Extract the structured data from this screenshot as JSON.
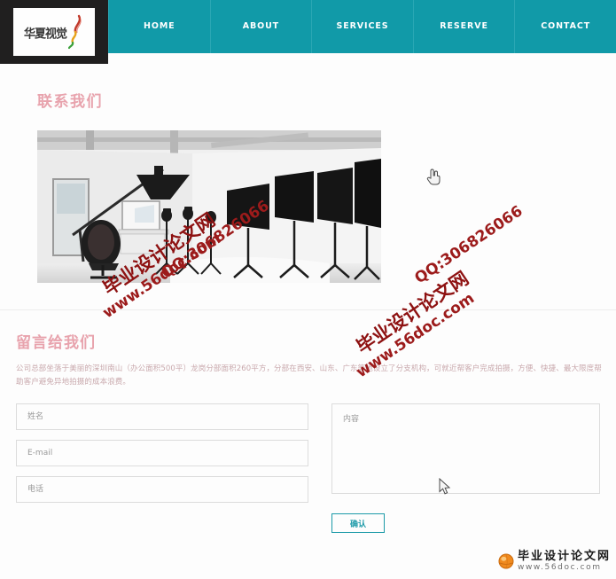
{
  "header": {
    "logo": {
      "text": "华夏视觉",
      "icon": "ribbon-swoosh-icon"
    },
    "nav": [
      {
        "label": "HOME"
      },
      {
        "label": "ABOUT"
      },
      {
        "label": "SERVICES"
      },
      {
        "label": "RESERVE"
      },
      {
        "label": "CONTACT"
      }
    ],
    "accent_color": "#119aa8"
  },
  "contact": {
    "title": "联系我们",
    "title_color": "#e8a3ad",
    "photo_alt": "photography-studio-photo"
  },
  "message": {
    "title": "留言给我们",
    "body": "公司总部坐落于美丽的深圳南山（办公面积500平）龙岗分部面积260平方，分部在西安、山东、广东等地设立了分支机构，可就近帮客户完成拍摄，方便、快捷、最大限度帮助客户避免异地拍摄的成本浪费。"
  },
  "form": {
    "name_placeholder": "姓名",
    "name_value": "",
    "email_placeholder": "E-mail",
    "email_value": "",
    "phone_placeholder": "电话",
    "phone_value": "",
    "content_placeholder": "内容",
    "content_value": "",
    "submit_label": "确认",
    "submit_color": "#1c9aa8"
  },
  "watermarks": [
    {
      "text": "QQ:306826066",
      "color": "#9c1b1b"
    },
    {
      "text": "毕业设计论文网",
      "color": "#8e1212"
    },
    {
      "text": "www.56doc.com",
      "color": "#9c1b1b"
    },
    {
      "text": "QQ:306826066",
      "color": "#9c1b1b"
    },
    {
      "text": "毕业设计论文网",
      "color": "#8e1212"
    },
    {
      "text": "www.56doc.com",
      "color": "#9c1b1b"
    }
  ],
  "footer": {
    "brand_cn": "毕业设计论文网",
    "brand_url": "www.56doc.com",
    "icon": "orange-ball-icon"
  }
}
